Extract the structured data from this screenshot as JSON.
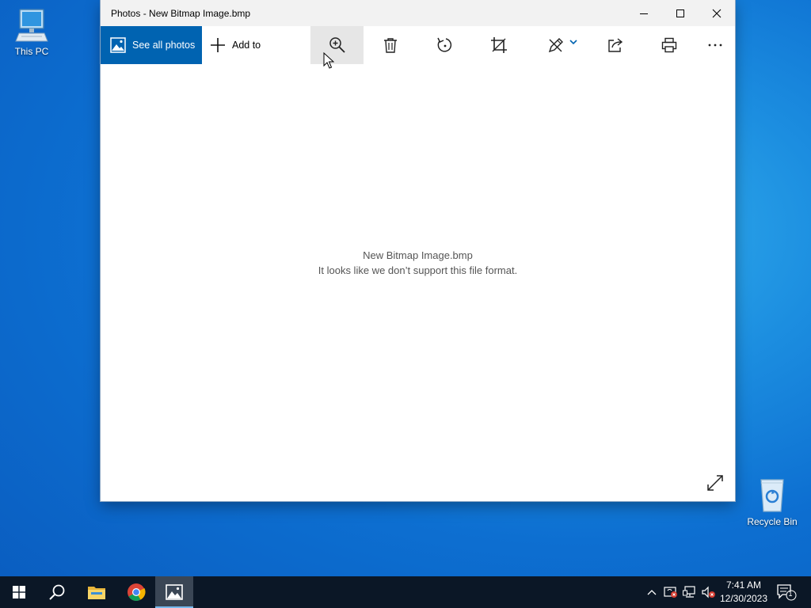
{
  "desktop": {
    "this_pc_label": "This PC",
    "recycle_bin_label": "Recycle Bin"
  },
  "window": {
    "title": "Photos - New Bitmap Image.bmp",
    "controls": [
      "minimize-icon",
      "maximize-icon",
      "close-icon"
    ],
    "toolbar": {
      "see_all_label": "See all photos",
      "add_to_label": "Add to",
      "icons": [
        "zoom-in-icon",
        "delete-icon",
        "rotate-icon",
        "crop-icon",
        "edit-icon",
        "share-icon",
        "print-icon",
        "more-icon"
      ]
    },
    "message": {
      "filename": "New Bitmap Image.bmp",
      "text": "It looks like we don’t support this file format."
    }
  },
  "taskbar": {
    "items": [
      "start-icon",
      "search-icon",
      "file-explorer-icon",
      "chrome-icon",
      "photos-icon"
    ],
    "clock": {
      "time": "7:41 AM",
      "date": "12/30/2023"
    },
    "notification_count": "1"
  },
  "colors": {
    "accent": "#0063b1",
    "taskbar": "#0b1726",
    "desktop": "#0d6fd1"
  }
}
